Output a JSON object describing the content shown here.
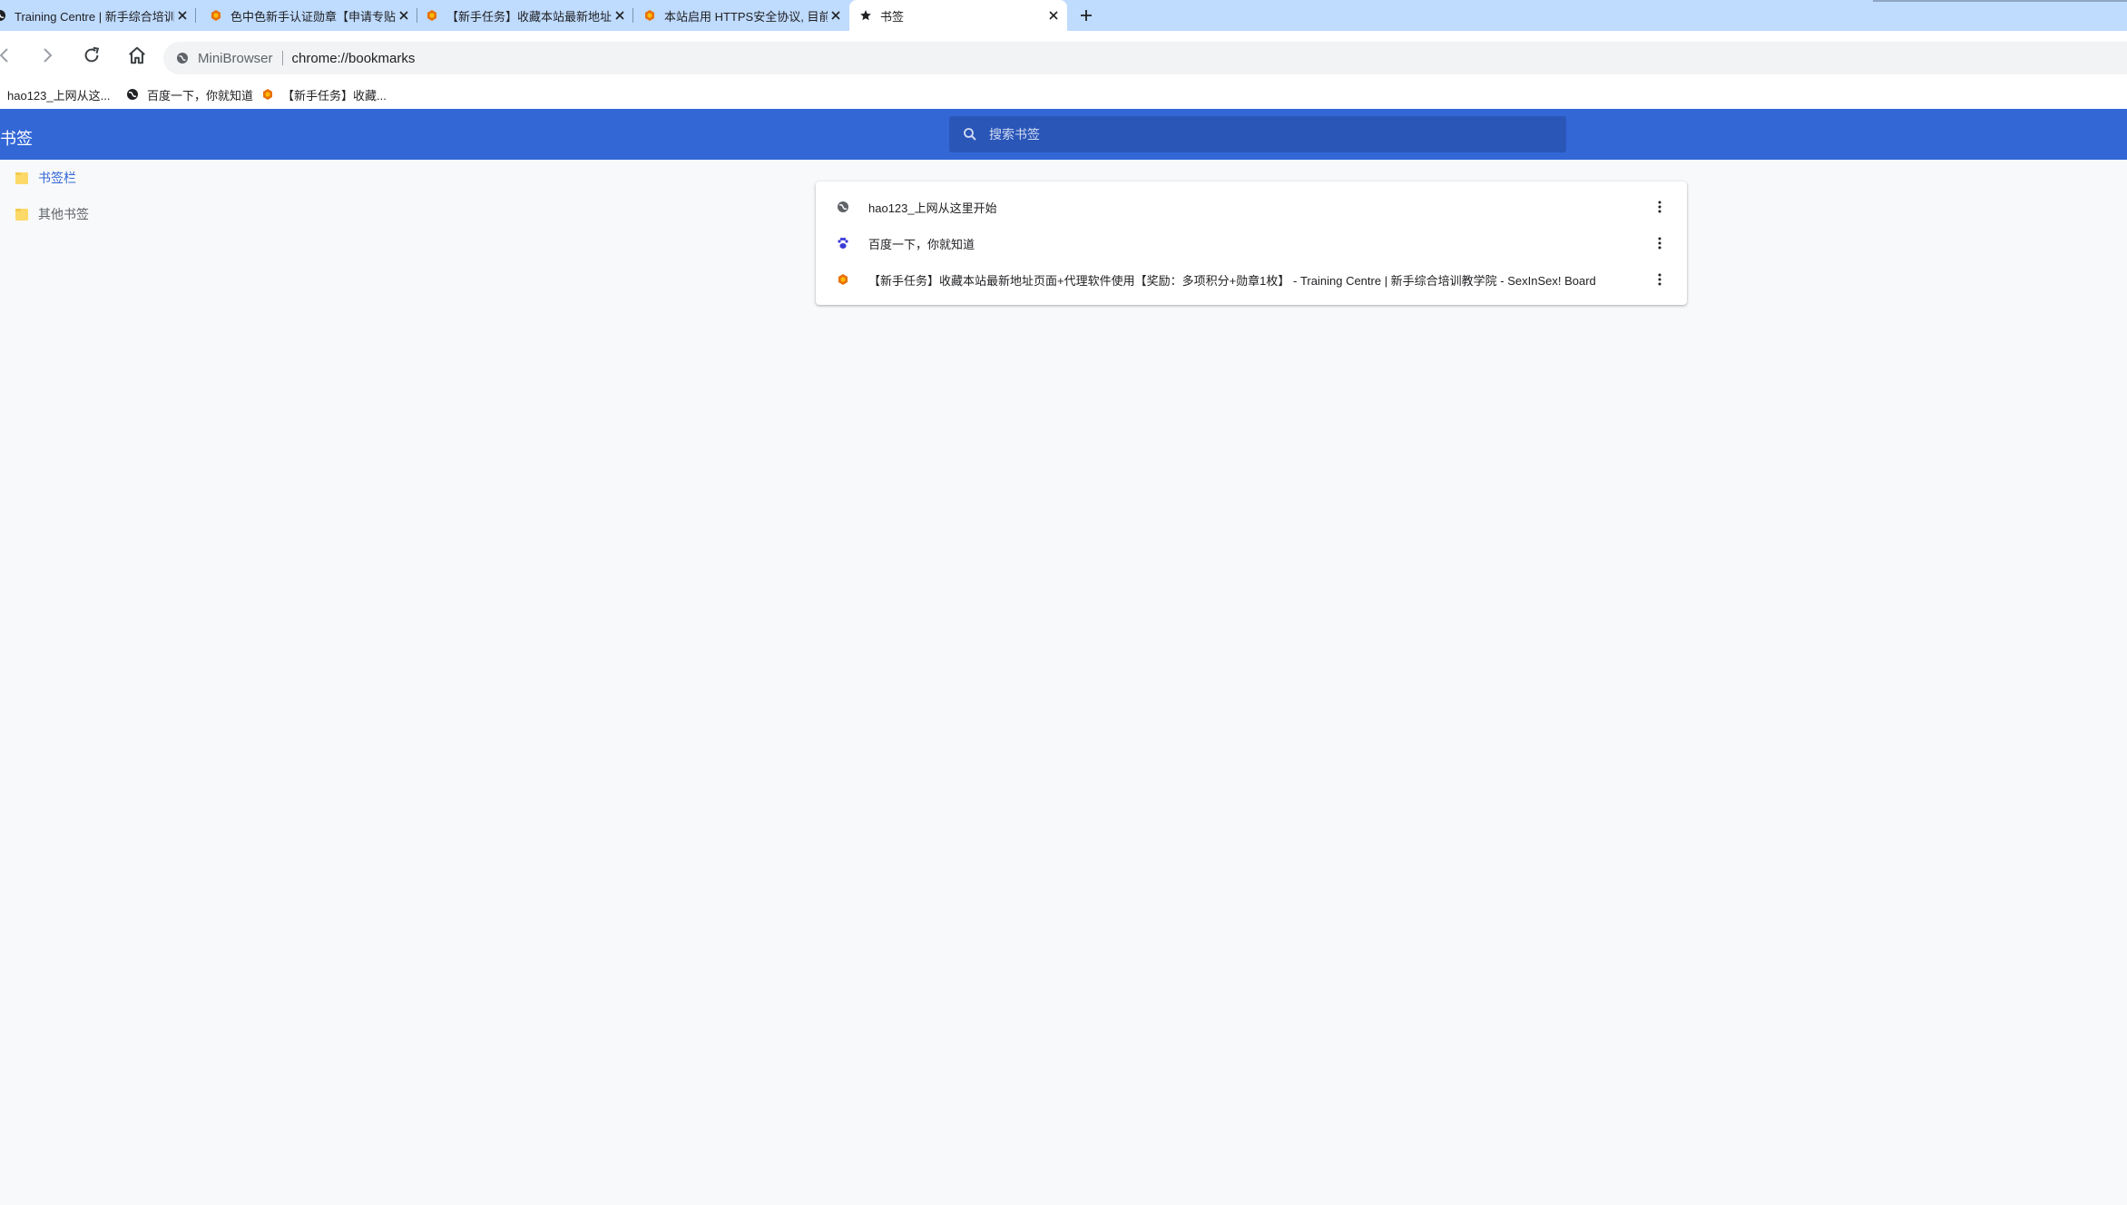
{
  "tabs": [
    {
      "title": "Training Centre | 新手综合培训教",
      "icon": "globe-icon",
      "active": false
    },
    {
      "title": "色中色新手认证勋章【申请专贴】",
      "icon": "forum-badge-icon",
      "active": false
    },
    {
      "title": "【新手任务】收藏本站最新地址页",
      "icon": "forum-badge-icon",
      "active": false
    },
    {
      "title": "本站启用 HTTPS安全协议, 目前支",
      "icon": "forum-badge-icon",
      "active": false
    },
    {
      "title": "书签",
      "icon": "star-icon",
      "active": true
    }
  ],
  "toolbar": {
    "site_name": "MiniBrowser",
    "url": "chrome://bookmarks"
  },
  "bookmarks_bar": [
    {
      "label": "hao123_上网从这...",
      "icon": "none"
    },
    {
      "label": "百度一下，你就知道",
      "icon": "globe-icon"
    },
    {
      "label": "【新手任务】收藏...",
      "icon": "forum-badge-icon"
    }
  ],
  "page": {
    "title": "书签",
    "search_placeholder": "搜索书签"
  },
  "sidebar": {
    "folders": [
      {
        "label": "书签栏",
        "selected": true
      },
      {
        "label": "其他书签",
        "selected": false
      }
    ]
  },
  "bookmarks": [
    {
      "title": "hao123_上网从这里开始",
      "icon": "globe-icon"
    },
    {
      "title": "百度一下，你就知道",
      "icon": "baidu-paw-icon"
    },
    {
      "title": "【新手任务】收藏本站最新地址页面+代理软件使用【奖励：多项积分+勋章1枚】 - Training Centre | 新手综合培训教学院 - SexInSex! Board",
      "icon": "forum-badge-icon"
    }
  ],
  "colors": {
    "header_blue": "#3367d6",
    "tabstrip_blue": "#bfdbfe",
    "folder_yellow": "#fcd968"
  }
}
